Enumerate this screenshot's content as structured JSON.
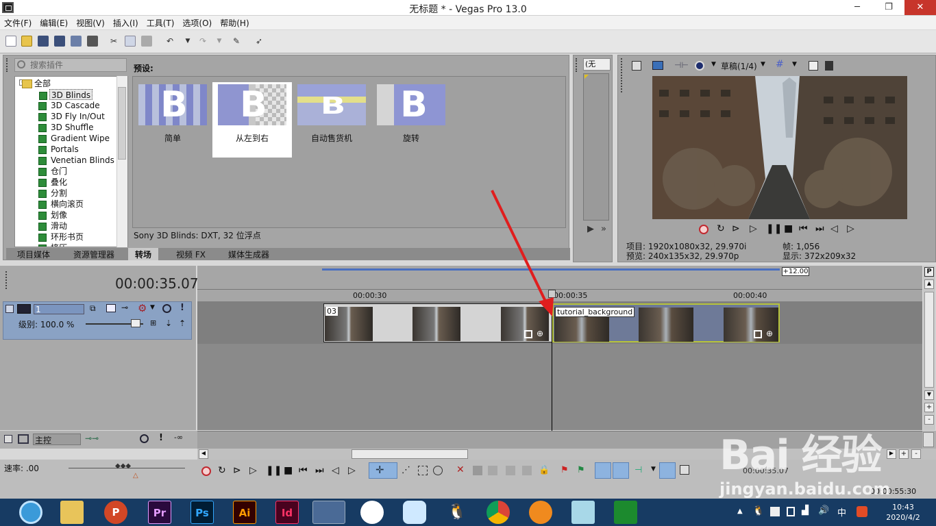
{
  "window": {
    "title": "无标题 * - Vegas Pro 13.0",
    "minimize": "─",
    "maximize": "❐",
    "close": "✕"
  },
  "menu": [
    "文件(F)",
    "编辑(E)",
    "视图(V)",
    "插入(I)",
    "工具(T)",
    "选项(O)",
    "帮助(H)"
  ],
  "plugins": {
    "search_placeholder": "搜索插件",
    "root": "全部",
    "items": [
      "3D Blinds",
      "3D Cascade",
      "3D Fly In/Out",
      "3D Shuffle",
      "Gradient Wipe",
      "Portals",
      "Venetian Blinds",
      "仓门",
      "叠化",
      "分割",
      "横向滚页",
      "划像",
      "滑动",
      "环形书页",
      "挤压"
    ],
    "selected": "3D Blinds"
  },
  "presets": {
    "label": "预设:",
    "items": [
      "简单",
      "从左到右",
      "自动售货机",
      "旋转"
    ],
    "selected": "从左到右",
    "thumb_letter": "B",
    "status": "Sony 3D Blinds: DXT, 32 位浮点"
  },
  "tabs": [
    "项目媒体",
    "资源管理器",
    "转场",
    "视频 FX",
    "媒体生成器"
  ],
  "active_tab": "转场",
  "trimmer": {
    "dropdown": "(无"
  },
  "preview": {
    "quality": "草稿(1/4)",
    "project_label": "项目:",
    "project_value": "1920x1080x32, 29.970i",
    "preview_label": "预览:",
    "preview_value": "240x135x32, 29.970p",
    "frame_label": "帧:",
    "frame_value": "1,056",
    "display_label": "显示:",
    "display_value": "372x209x32"
  },
  "timeline": {
    "timecode": "00:00:35.07",
    "marker": "+12.00",
    "ruler": [
      "00:00:30",
      "00:00:35",
      "00:00:40"
    ],
    "track_number": "1",
    "level": "级别: 100.0 %",
    "clip1_label": "03",
    "clip2_label": "tutorial_background",
    "master": "主控",
    "rate": "速率: .00",
    "time_readout": "00:00:35.07",
    "end_time": "00:00:55:30"
  },
  "taskbar": {
    "apps": [
      "Pr",
      "Ps",
      "Ai",
      "Id"
    ],
    "time": "10:43",
    "date": "2020/4/2"
  },
  "watermark": {
    "brand": "Bai 经验",
    "url": "jingyan.baidu.com"
  }
}
